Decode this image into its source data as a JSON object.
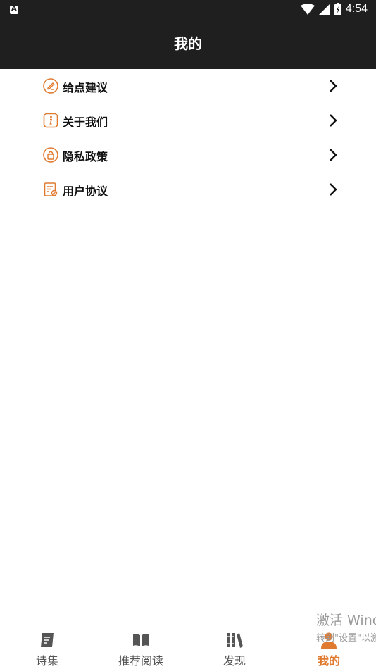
{
  "status_bar": {
    "time": "4:54"
  },
  "app_bar": {
    "title": "我的"
  },
  "menu": {
    "items": [
      {
        "label": "给点建议",
        "icon": "feedback-edit-icon"
      },
      {
        "label": "关于我们",
        "icon": "info-icon"
      },
      {
        "label": "隐私政策",
        "icon": "privacy-lock-icon"
      },
      {
        "label": "用户协议",
        "icon": "agreement-document-icon"
      }
    ]
  },
  "bottom_nav": {
    "items": [
      {
        "label": "诗集",
        "icon": "scroll-icon"
      },
      {
        "label": "推荐阅读",
        "icon": "book-open-icon"
      },
      {
        "label": "发现",
        "icon": "books-shelf-icon"
      },
      {
        "label": "我的",
        "icon": "user-icon",
        "active": true
      }
    ]
  },
  "watermark": {
    "line1": "激活 Windows",
    "line2": "转到\"设置\"以激活 Windows"
  },
  "colors": {
    "accent": "#e07a2f",
    "header_bg": "#1f1f1f",
    "icon_gray": "#555555"
  }
}
